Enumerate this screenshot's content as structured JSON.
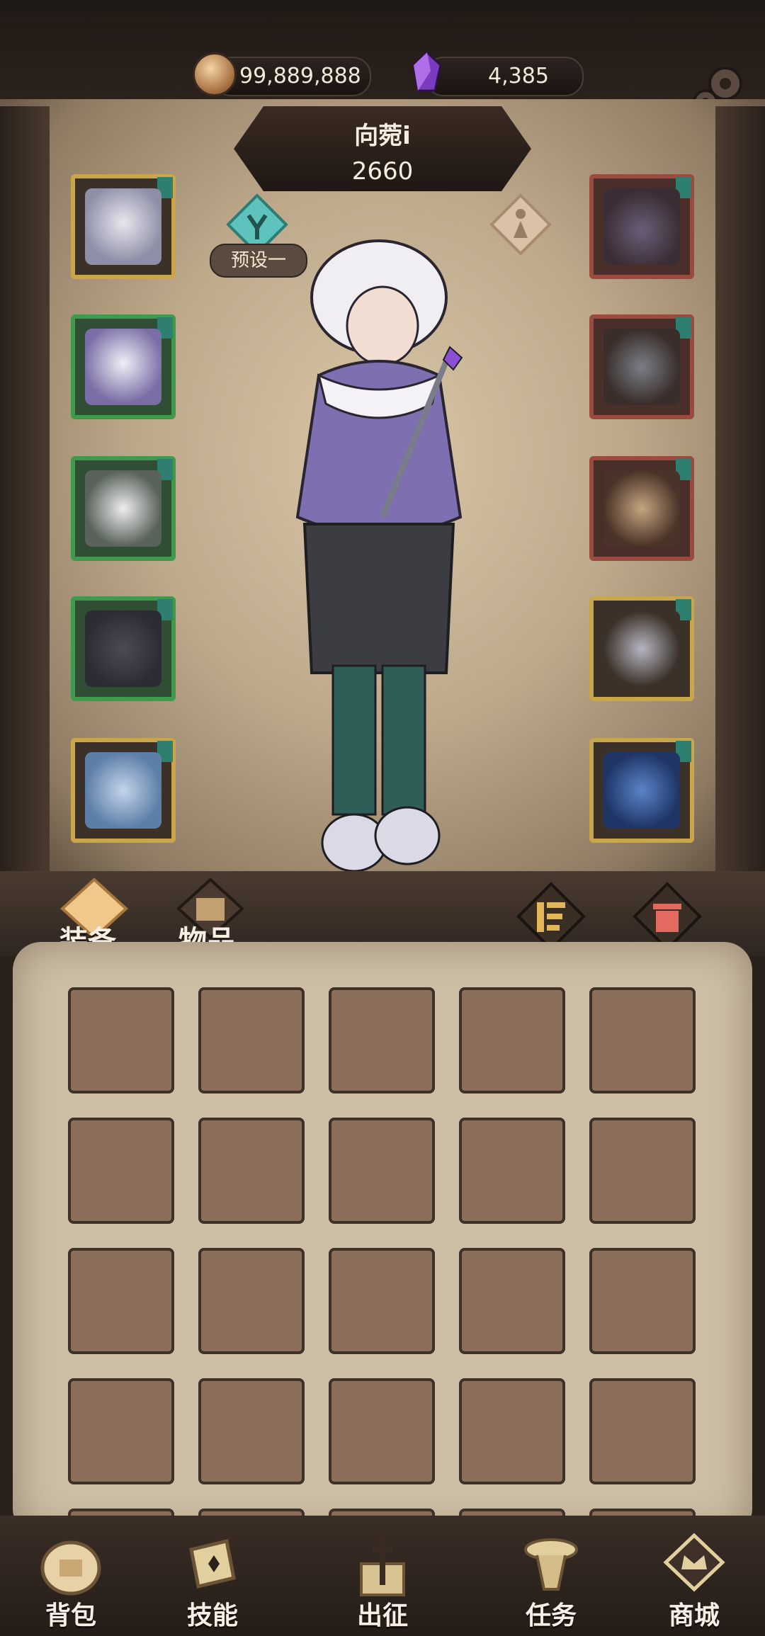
{
  "resources": {
    "coins": "99,889,888",
    "gems": "4,385",
    "coin_icon": "gold-coin-icon",
    "gem_icon": "purple-crystal-icon"
  },
  "character": {
    "name": "向菀i",
    "power": "2660",
    "preset_label": "预设一"
  },
  "slots_left": [
    {
      "icon": "hat-icon",
      "rarity": "gold"
    },
    {
      "icon": "coat-icon",
      "rarity": "green"
    },
    {
      "icon": "gloves-icon",
      "rarity": "green"
    },
    {
      "icon": "pants-icon",
      "rarity": "green"
    },
    {
      "icon": "boots-icon",
      "rarity": "gold"
    }
  ],
  "slots_right": [
    {
      "icon": "necklace-icon",
      "rarity": "red"
    },
    {
      "icon": "ring-icon",
      "rarity": "red"
    },
    {
      "icon": "bracelet-icon",
      "rarity": "red"
    },
    {
      "icon": "staff-icon",
      "rarity": "gold"
    },
    {
      "icon": "spellbook-icon",
      "rarity": "gold"
    }
  ],
  "tabs": {
    "equipment": "装备",
    "items": "物品"
  },
  "nav": [
    {
      "label": "背包",
      "icon": "backpack-icon"
    },
    {
      "label": "技能",
      "icon": "skill-book-icon"
    },
    {
      "label": "出征",
      "icon": "battle-sword-icon"
    },
    {
      "label": "任务",
      "icon": "quest-scroll-icon"
    },
    {
      "label": "商城",
      "icon": "shop-crown-icon"
    }
  ],
  "colors": {
    "gold": "#c9a64a",
    "green": "#3f9a4b",
    "red": "#9a4b3e",
    "slot_fill": "#8c6f5a"
  }
}
